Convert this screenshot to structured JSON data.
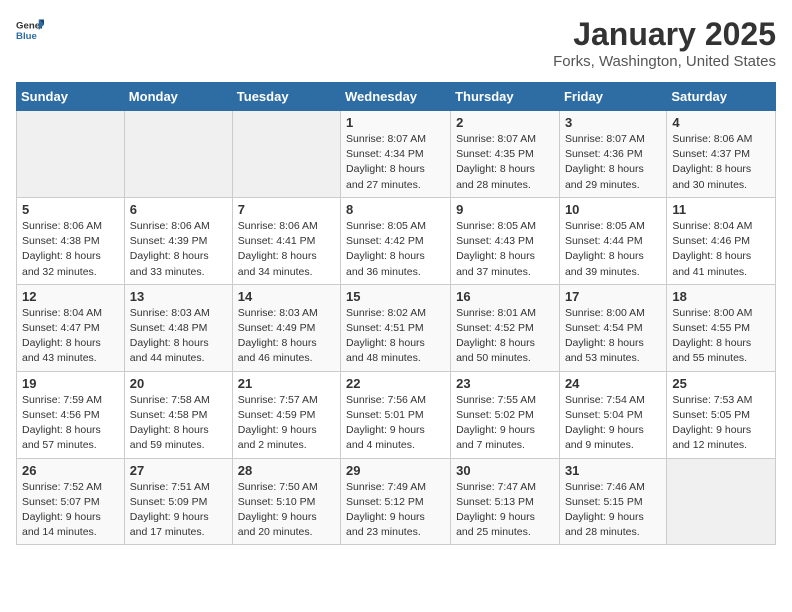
{
  "header": {
    "logo_general": "General",
    "logo_blue": "Blue",
    "title": "January 2025",
    "location": "Forks, Washington, United States"
  },
  "weekdays": [
    "Sunday",
    "Monday",
    "Tuesday",
    "Wednesday",
    "Thursday",
    "Friday",
    "Saturday"
  ],
  "weeks": [
    [
      {
        "day": "",
        "info": ""
      },
      {
        "day": "",
        "info": ""
      },
      {
        "day": "",
        "info": ""
      },
      {
        "day": "1",
        "info": "Sunrise: 8:07 AM\nSunset: 4:34 PM\nDaylight: 8 hours\nand 27 minutes."
      },
      {
        "day": "2",
        "info": "Sunrise: 8:07 AM\nSunset: 4:35 PM\nDaylight: 8 hours\nand 28 minutes."
      },
      {
        "day": "3",
        "info": "Sunrise: 8:07 AM\nSunset: 4:36 PM\nDaylight: 8 hours\nand 29 minutes."
      },
      {
        "day": "4",
        "info": "Sunrise: 8:06 AM\nSunset: 4:37 PM\nDaylight: 8 hours\nand 30 minutes."
      }
    ],
    [
      {
        "day": "5",
        "info": "Sunrise: 8:06 AM\nSunset: 4:38 PM\nDaylight: 8 hours\nand 32 minutes."
      },
      {
        "day": "6",
        "info": "Sunrise: 8:06 AM\nSunset: 4:39 PM\nDaylight: 8 hours\nand 33 minutes."
      },
      {
        "day": "7",
        "info": "Sunrise: 8:06 AM\nSunset: 4:41 PM\nDaylight: 8 hours\nand 34 minutes."
      },
      {
        "day": "8",
        "info": "Sunrise: 8:05 AM\nSunset: 4:42 PM\nDaylight: 8 hours\nand 36 minutes."
      },
      {
        "day": "9",
        "info": "Sunrise: 8:05 AM\nSunset: 4:43 PM\nDaylight: 8 hours\nand 37 minutes."
      },
      {
        "day": "10",
        "info": "Sunrise: 8:05 AM\nSunset: 4:44 PM\nDaylight: 8 hours\nand 39 minutes."
      },
      {
        "day": "11",
        "info": "Sunrise: 8:04 AM\nSunset: 4:46 PM\nDaylight: 8 hours\nand 41 minutes."
      }
    ],
    [
      {
        "day": "12",
        "info": "Sunrise: 8:04 AM\nSunset: 4:47 PM\nDaylight: 8 hours\nand 43 minutes."
      },
      {
        "day": "13",
        "info": "Sunrise: 8:03 AM\nSunset: 4:48 PM\nDaylight: 8 hours\nand 44 minutes."
      },
      {
        "day": "14",
        "info": "Sunrise: 8:03 AM\nSunset: 4:49 PM\nDaylight: 8 hours\nand 46 minutes."
      },
      {
        "day": "15",
        "info": "Sunrise: 8:02 AM\nSunset: 4:51 PM\nDaylight: 8 hours\nand 48 minutes."
      },
      {
        "day": "16",
        "info": "Sunrise: 8:01 AM\nSunset: 4:52 PM\nDaylight: 8 hours\nand 50 minutes."
      },
      {
        "day": "17",
        "info": "Sunrise: 8:00 AM\nSunset: 4:54 PM\nDaylight: 8 hours\nand 53 minutes."
      },
      {
        "day": "18",
        "info": "Sunrise: 8:00 AM\nSunset: 4:55 PM\nDaylight: 8 hours\nand 55 minutes."
      }
    ],
    [
      {
        "day": "19",
        "info": "Sunrise: 7:59 AM\nSunset: 4:56 PM\nDaylight: 8 hours\nand 57 minutes."
      },
      {
        "day": "20",
        "info": "Sunrise: 7:58 AM\nSunset: 4:58 PM\nDaylight: 8 hours\nand 59 minutes."
      },
      {
        "day": "21",
        "info": "Sunrise: 7:57 AM\nSunset: 4:59 PM\nDaylight: 9 hours\nand 2 minutes."
      },
      {
        "day": "22",
        "info": "Sunrise: 7:56 AM\nSunset: 5:01 PM\nDaylight: 9 hours\nand 4 minutes."
      },
      {
        "day": "23",
        "info": "Sunrise: 7:55 AM\nSunset: 5:02 PM\nDaylight: 9 hours\nand 7 minutes."
      },
      {
        "day": "24",
        "info": "Sunrise: 7:54 AM\nSunset: 5:04 PM\nDaylight: 9 hours\nand 9 minutes."
      },
      {
        "day": "25",
        "info": "Sunrise: 7:53 AM\nSunset: 5:05 PM\nDaylight: 9 hours\nand 12 minutes."
      }
    ],
    [
      {
        "day": "26",
        "info": "Sunrise: 7:52 AM\nSunset: 5:07 PM\nDaylight: 9 hours\nand 14 minutes."
      },
      {
        "day": "27",
        "info": "Sunrise: 7:51 AM\nSunset: 5:09 PM\nDaylight: 9 hours\nand 17 minutes."
      },
      {
        "day": "28",
        "info": "Sunrise: 7:50 AM\nSunset: 5:10 PM\nDaylight: 9 hours\nand 20 minutes."
      },
      {
        "day": "29",
        "info": "Sunrise: 7:49 AM\nSunset: 5:12 PM\nDaylight: 9 hours\nand 23 minutes."
      },
      {
        "day": "30",
        "info": "Sunrise: 7:47 AM\nSunset: 5:13 PM\nDaylight: 9 hours\nand 25 minutes."
      },
      {
        "day": "31",
        "info": "Sunrise: 7:46 AM\nSunset: 5:15 PM\nDaylight: 9 hours\nand 28 minutes."
      },
      {
        "day": "",
        "info": ""
      }
    ]
  ]
}
